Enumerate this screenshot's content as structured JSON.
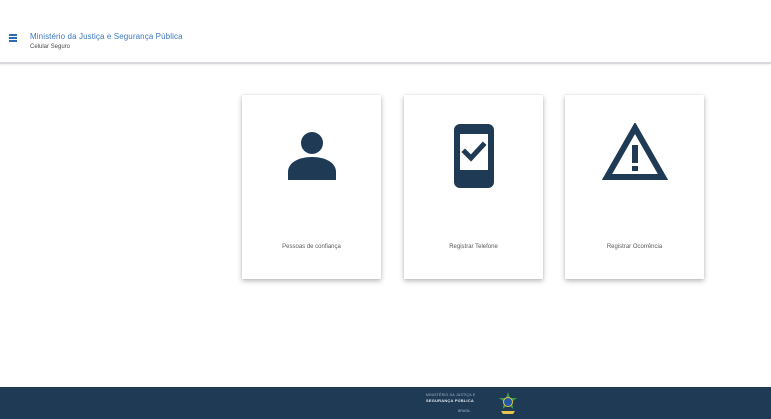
{
  "header": {
    "org_title": "Ministério da Justiça e Segurança Pública",
    "app_subtitle": "Celular Seguro",
    "accent_color": "#3b78c2"
  },
  "cards": [
    {
      "label": "Pessoas de confiança",
      "icon": "person-icon"
    },
    {
      "label": "Registrar Telefone",
      "icon": "phone-check-icon"
    },
    {
      "label": "Registrar Ocorrência",
      "icon": "warning-icon"
    }
  ],
  "footer": {
    "line1": "MINISTÉRIO DA JUSTIÇA E",
    "line2": "SEGURANÇA PÚBLICA",
    "line3": "BRASIL",
    "background_color": "#1e3a55"
  }
}
